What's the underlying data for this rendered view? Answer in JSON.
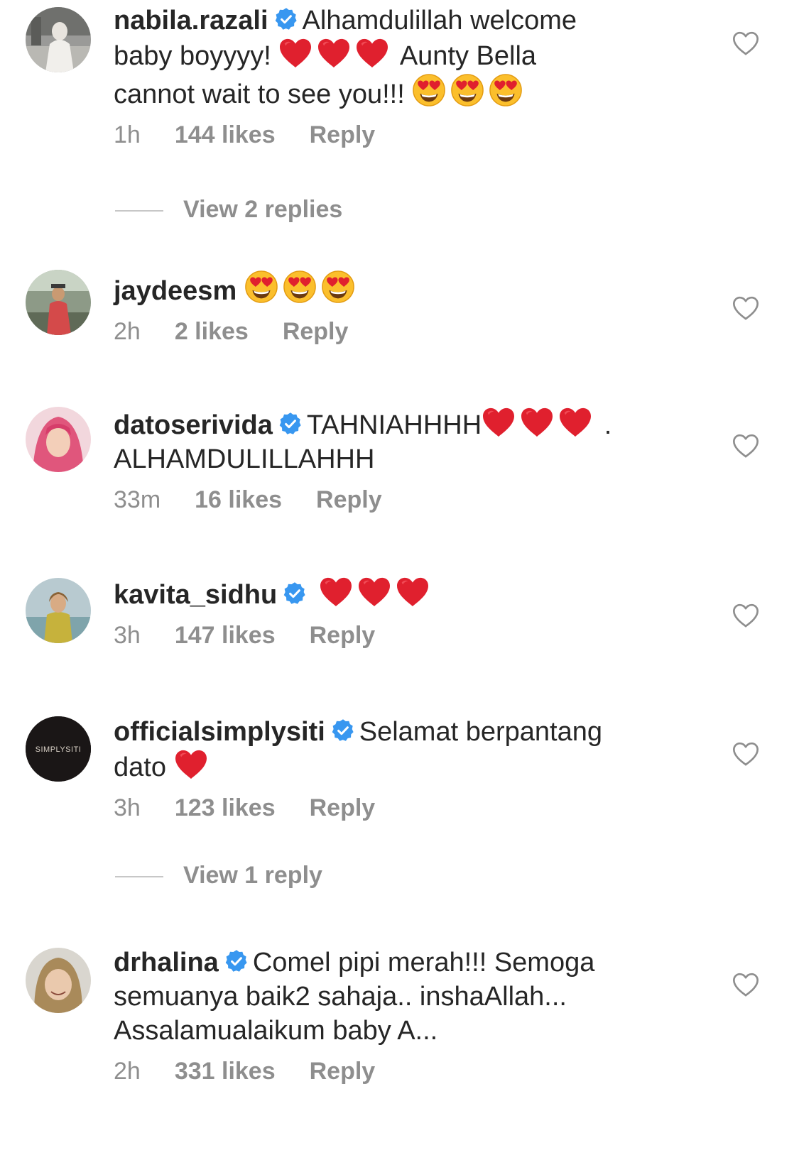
{
  "comments": [
    {
      "username": "nabila.razali",
      "verified": true,
      "text_parts": [
        "Alhamdulillah welcome",
        "baby boyyyy!",
        "Aunty Bella",
        "cannot wait to see you!!!"
      ],
      "time": "1h",
      "likes": "144 likes",
      "reply": "Reply",
      "view_replies": "View 2 replies"
    },
    {
      "username": "jaydeesm",
      "verified": false,
      "text_parts": [],
      "time": "2h",
      "likes": "2 likes",
      "reply": "Reply"
    },
    {
      "username": "datoserivida",
      "verified": true,
      "text_parts": [
        "TAHNIAHHHH",
        ".",
        "ALHAMDULILLAHHH"
      ],
      "time": "33m",
      "likes": "16 likes",
      "reply": "Reply"
    },
    {
      "username": "kavita_sidhu",
      "verified": true,
      "text_parts": [],
      "time": "3h",
      "likes": "147 likes",
      "reply": "Reply"
    },
    {
      "username": "officialsimplysiti",
      "verified": true,
      "avatar_text": "SIMPLYSITI",
      "text_parts": [
        "Selamat berpantang",
        "dato"
      ],
      "time": "3h",
      "likes": "123 likes",
      "reply": "Reply",
      "view_replies": "View 1 reply"
    },
    {
      "username": "drhalina",
      "verified": true,
      "text_parts": [
        "Comel pipi merah!!! Semoga",
        "semuanya baik2 sahaja.. inshaAllah...",
        "Assalamualaikum baby A..."
      ],
      "time": "2h",
      "likes": "331 likes",
      "reply": "Reply"
    }
  ],
  "icons": {
    "verified": "verified-badge-icon",
    "like": "heart-outline-icon",
    "heart_emoji": "red-heart-emoji",
    "heart_eyes_emoji": "heart-eyes-emoji"
  },
  "colors": {
    "verified_blue": "#3897f0",
    "meta_gray": "#8e8e8e",
    "text": "#262626",
    "heart_red": "#e0202e"
  }
}
